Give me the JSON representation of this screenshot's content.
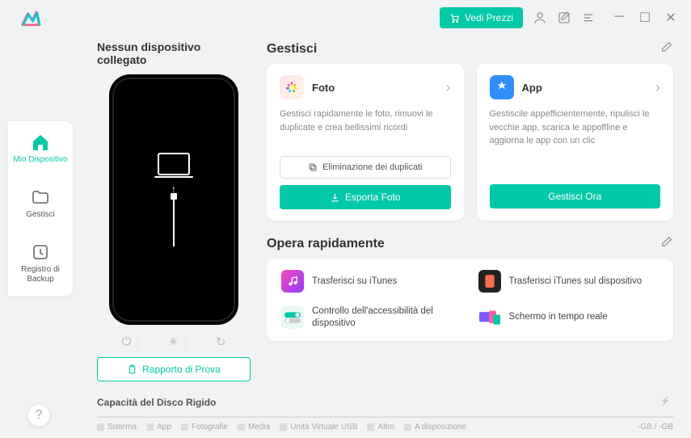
{
  "titlebar": {
    "price_button": "Vedi Prezzi"
  },
  "sidebar": {
    "items": [
      {
        "label": "Mio Dispositivo"
      },
      {
        "label": "Gestisci"
      },
      {
        "label": "Registro di Backup"
      }
    ]
  },
  "device": {
    "title": "Nessun dispositivo collegato",
    "report_button": "Rapporto di Prova"
  },
  "manage": {
    "section_title": "Gestisci",
    "cards": [
      {
        "title": "Foto",
        "desc": "Gestisci rapidamente le foto, rimuovi le duplicate e crea bellissimi ricordi",
        "secondary": "Eliminazione dei duplicati",
        "primary": "Esporta Foto"
      },
      {
        "title": "App",
        "desc": "Gestiscile appefficientemente, ripulisci le vecchie app, scarica le appoffline e aggiorna le app con un clic",
        "primary": "Gestisci Ora"
      }
    ]
  },
  "quick": {
    "section_title": "Opera rapidamente",
    "items": [
      {
        "label": "Trasferisci su iTunes"
      },
      {
        "label": "Trasferisci iTunes sul dispositivo"
      },
      {
        "label": "Controllo dell'accessibilità del dispositivo"
      },
      {
        "label": "Schermo in tempo reale"
      }
    ]
  },
  "disk": {
    "title": "Capacità del Disco Rigido",
    "legend": [
      "Sistema",
      "App",
      "Fotografie",
      "Media",
      "Unità Virtuale USB",
      "Altro",
      "A disposizione"
    ],
    "values": "-GB / -GB"
  }
}
